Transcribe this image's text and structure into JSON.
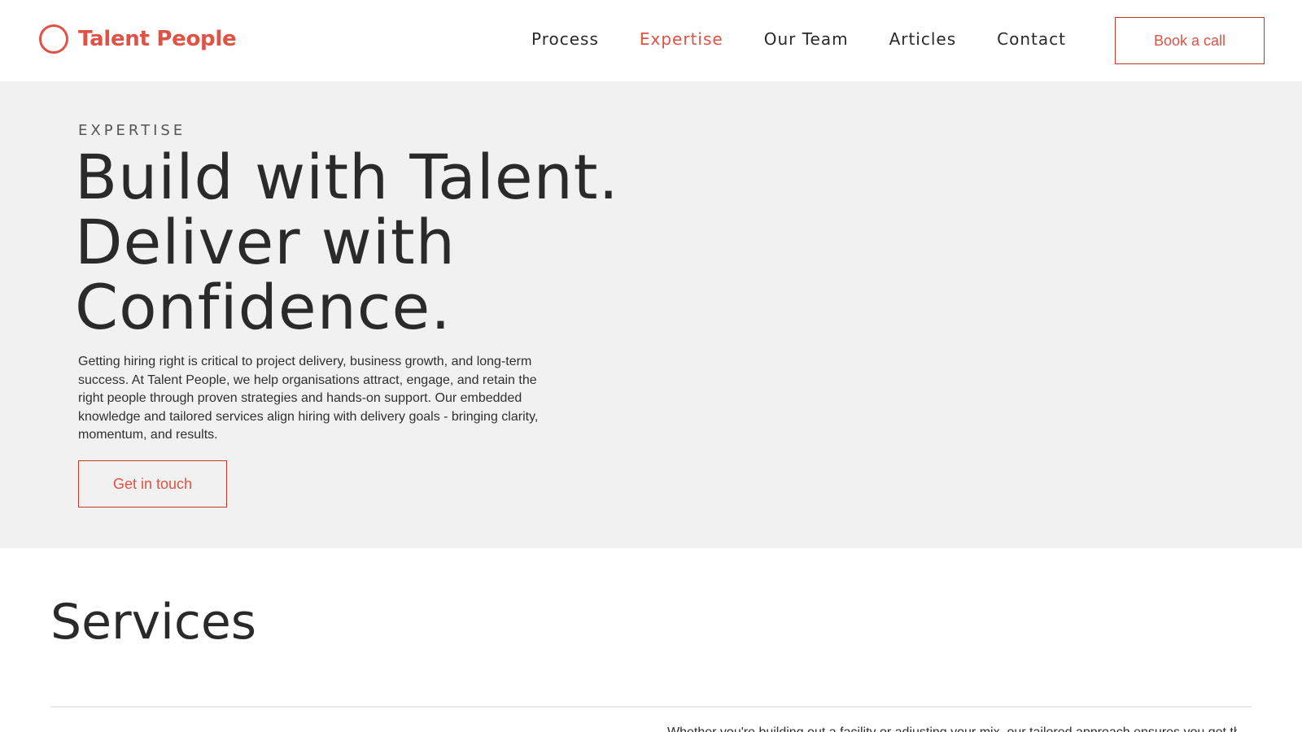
{
  "header": {
    "logo_text": "Talent People",
    "nav": [
      {
        "label": "Process",
        "active": false
      },
      {
        "label": "Expertise",
        "active": true
      },
      {
        "label": "Our Team",
        "active": false
      },
      {
        "label": "Articles",
        "active": false
      },
      {
        "label": "Contact",
        "active": false
      }
    ],
    "book_label": "Book a call"
  },
  "hero": {
    "eyebrow": "EXPERTISE",
    "title_lines": [
      "Build with Talent.",
      "Deliver with",
      "Confidence."
    ],
    "description": "Getting hiring right is critical to project delivery, business growth, and long-term success. At Talent People, we help organisations attract, engage, and retain the right people through proven strategies and hands-on support. Our embedded knowledge and tailored services align hiring with delivery goals - bringing clarity, momentum, and results.",
    "cta_label": "Get in touch"
  },
  "services": {
    "title": "Services",
    "intro_partial": "Whether you're building out a facility or adjusting your mix, our tailored approach ensures you get the right people"
  },
  "colors": {
    "accent": "#e05244",
    "hero_bg": "#f1f1f1",
    "text": "#2a2a2a"
  }
}
